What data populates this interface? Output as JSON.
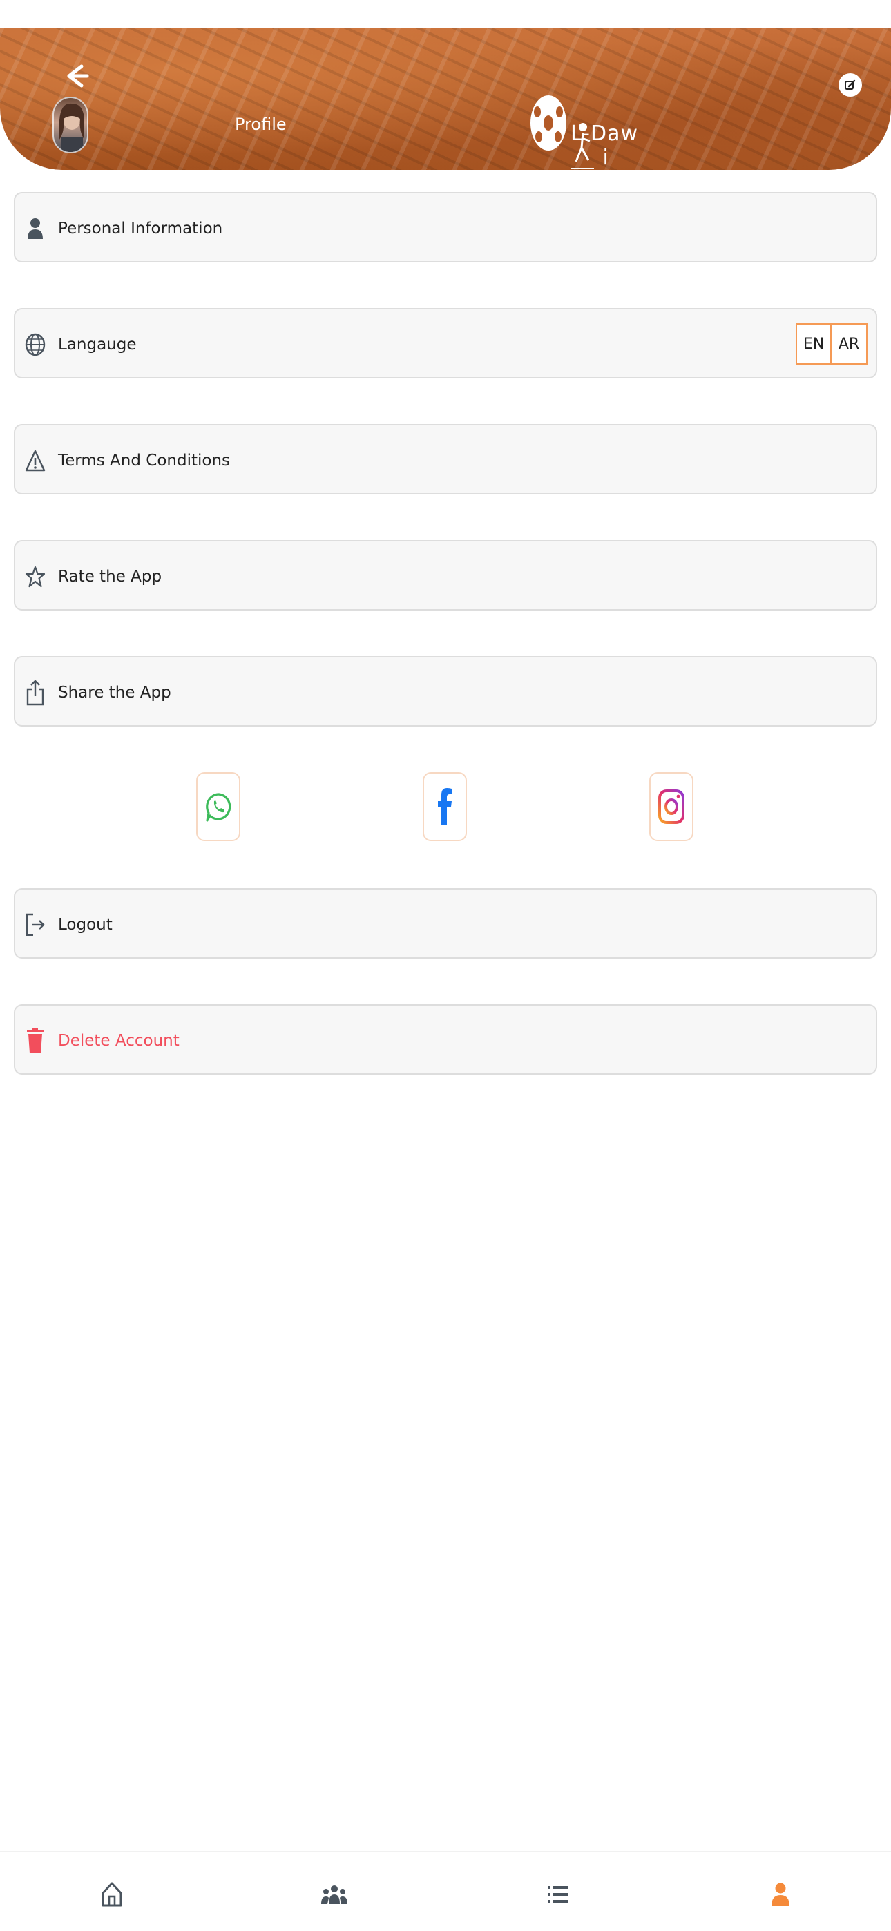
{
  "header": {
    "title": "Profile",
    "logo_text": "L-Daw",
    "logo_text_suffix": "i"
  },
  "menu": {
    "personal_information": "Personal Information",
    "language": "Langauge",
    "language_options": [
      "EN",
      "AR"
    ],
    "terms": "Terms And Conditions",
    "rate": "Rate the App",
    "share": "Share the App",
    "logout": "Logout",
    "delete_account": "Delete Account"
  },
  "social": {
    "icons": [
      "whatsapp-icon",
      "facebook-icon",
      "instagram-icon"
    ]
  },
  "bottom_nav": {
    "items": [
      "home-icon",
      "group-icon",
      "list-icon",
      "profile-icon"
    ],
    "active_index": 3
  },
  "colors": {
    "accent": "#f58a3a",
    "danger": "#f24e5c",
    "row_bg": "#f7f7f7"
  }
}
